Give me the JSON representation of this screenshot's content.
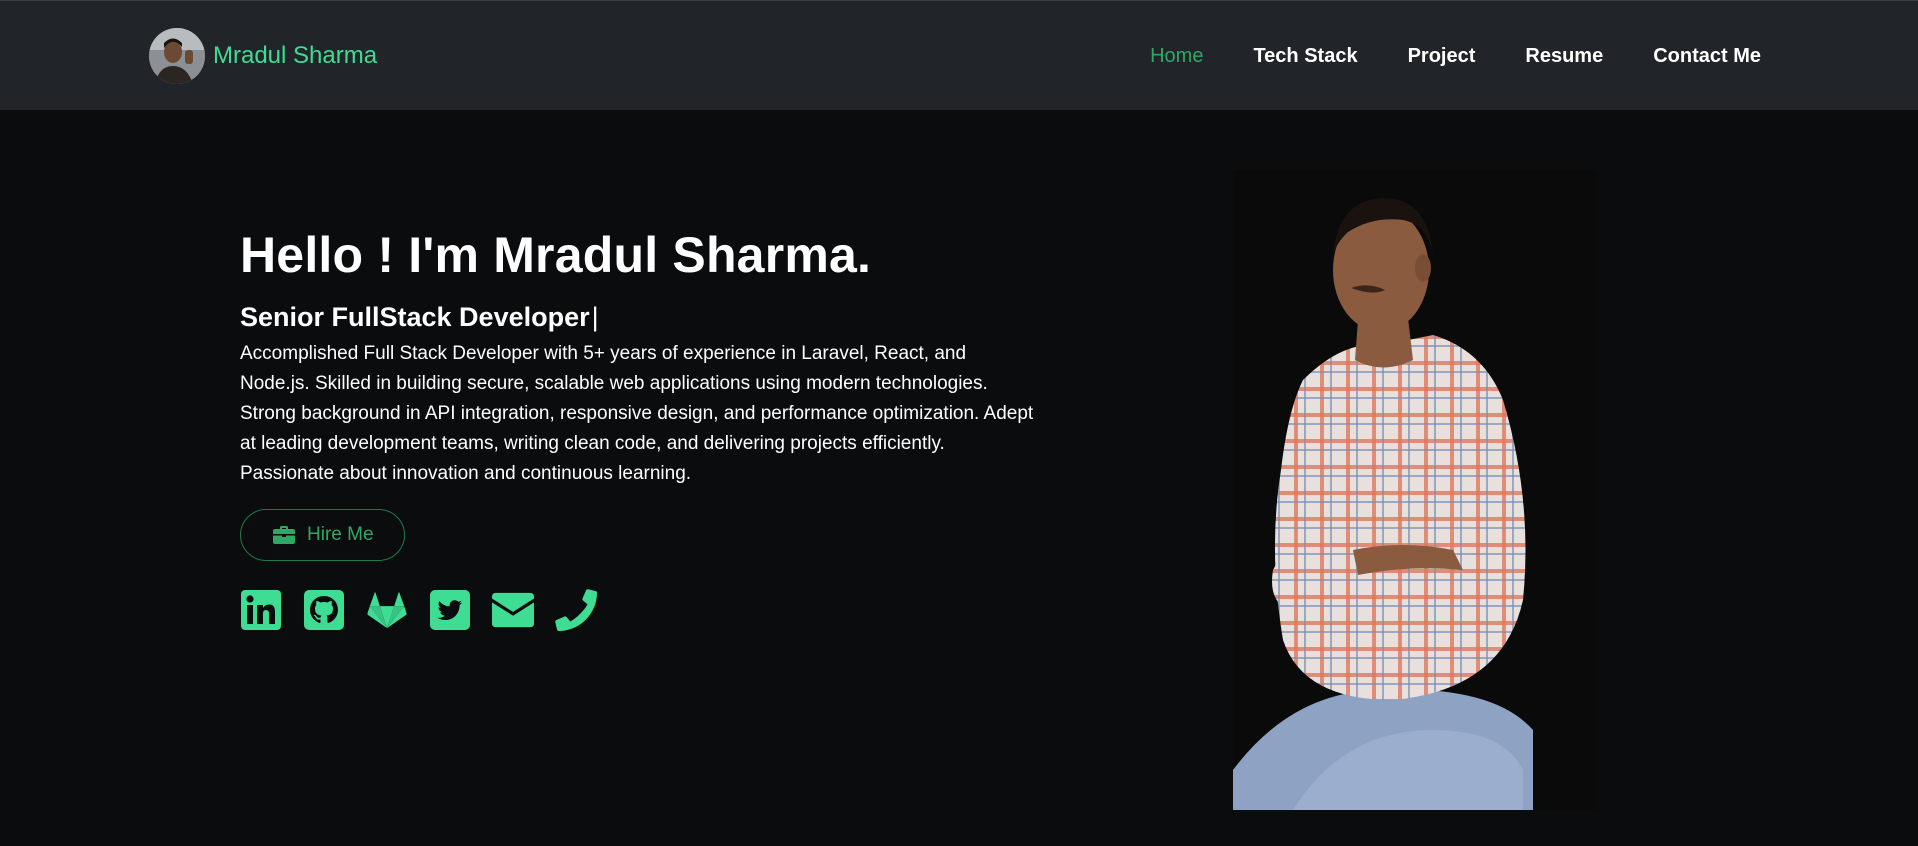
{
  "brand": {
    "name": "Mradul Sharma",
    "avatar_icon": "profile-photo"
  },
  "nav": {
    "items": [
      {
        "label": "Home",
        "active": true
      },
      {
        "label": "Tech Stack",
        "active": false
      },
      {
        "label": "Project",
        "active": false
      },
      {
        "label": "Resume",
        "active": false
      },
      {
        "label": "Contact Me",
        "active": false
      }
    ]
  },
  "hero": {
    "title": "Hello ! I'm Mradul Sharma.",
    "subtitle": "Senior FullStack Developer",
    "cursor": "|",
    "description": "Accomplished Full Stack Developer with 5+ years of experience in Laravel, React, and Node.js. Skilled in building secure, scalable web applications using modern technologies. Strong background in API integration, responsive design, and performance optimization. Adept at leading development teams, writing clean code, and delivering projects efficiently. Passionate about innovation and continuous learning.",
    "hire_button": {
      "label": "Hire Me",
      "icon": "briefcase-icon"
    },
    "socials": [
      {
        "name": "linkedin-icon"
      },
      {
        "name": "github-icon"
      },
      {
        "name": "gitlab-icon"
      },
      {
        "name": "twitter-icon"
      },
      {
        "name": "envelope-icon"
      },
      {
        "name": "phone-icon"
      }
    ]
  },
  "colors": {
    "accent": "#3fdc94",
    "nav_active": "#2fa866",
    "navbar_bg": "#212429",
    "page_bg": "#0b0c0e",
    "text": "#ffffff"
  }
}
